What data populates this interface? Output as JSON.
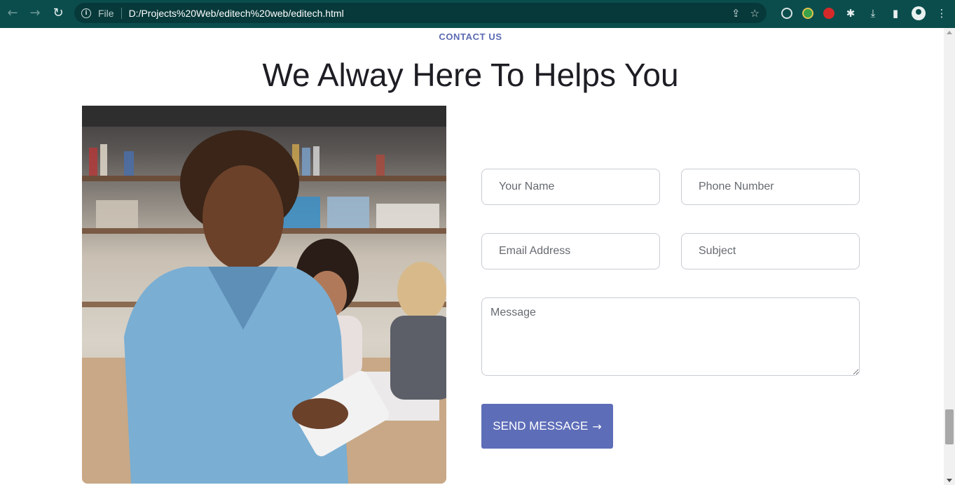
{
  "browser": {
    "scheme_label": "File",
    "url": "D:/Projects%20Web/editech%20web/editech.html",
    "nav_back": "←",
    "nav_forward": "→",
    "reload": "↻",
    "share_icon": "⇪",
    "bookmark_icon": "☆",
    "extensions_icon": "✱",
    "download_icon": "⤓",
    "sidepanel_icon": "▮",
    "menu_icon": "⋮"
  },
  "section": {
    "eyebrow": "CONTACT US",
    "title": "We Alway Here To Helps You"
  },
  "form": {
    "name_placeholder": "Your Name",
    "phone_placeholder": "Phone Number",
    "email_placeholder": "Email Address",
    "subject_placeholder": "Subject",
    "message_placeholder": "Message",
    "submit_label": "SEND MESSAGE",
    "submit_arrow": "→"
  },
  "colors": {
    "chrome": "#0b4d4d",
    "accent": "#5d6db8",
    "eyebrow": "#5b6ab2",
    "heading": "#1d1d24"
  }
}
